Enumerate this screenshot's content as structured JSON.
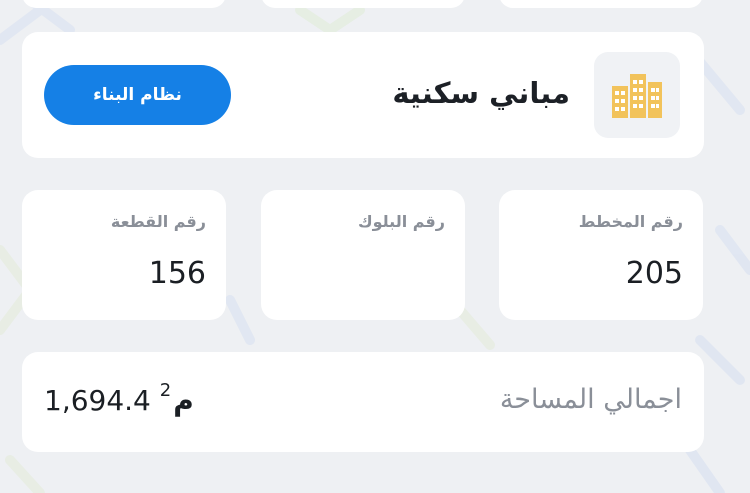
{
  "building": {
    "title": "مباني سكنية",
    "icon": "buildings-icon",
    "button_label": "نظام البناء"
  },
  "info": {
    "plan": {
      "label": "رقم المخطط",
      "value": "205"
    },
    "block": {
      "label": "رقم البلوك",
      "value": ""
    },
    "plot": {
      "label": "رقم القطعة",
      "value": "156"
    }
  },
  "area": {
    "label": "اجمالي المساحة",
    "value": "1,694.4",
    "unit": "م",
    "unit_power": "2"
  },
  "colors": {
    "accent": "#1580e6",
    "icon_fill": "#f2c35b",
    "muted_text": "#8a8f98",
    "background": "#eef0f3"
  }
}
